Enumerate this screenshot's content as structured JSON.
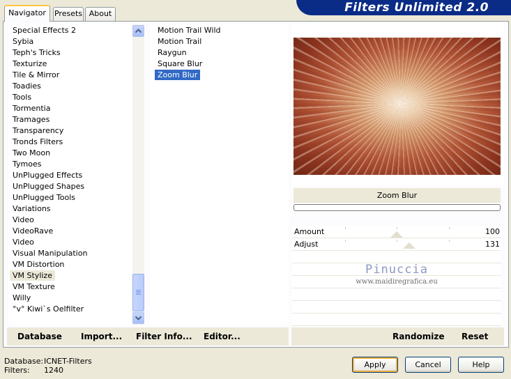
{
  "tabs": [
    {
      "label": "Navigator",
      "active": true
    },
    {
      "label": "Presets",
      "active": false
    },
    {
      "label": "About",
      "active": false
    }
  ],
  "banner_title": "Filters Unlimited 2.0",
  "categories": [
    "Special Effects 2",
    "Sybia",
    "Teph's Tricks",
    "Texturize",
    "Tile & Mirror",
    "Toadies",
    "Tools",
    "Tormentia",
    "Tramages",
    "Transparency",
    "Tronds Filters",
    "Two Moon",
    "Tymoes",
    "UnPlugged Effects",
    "UnPlugged Shapes",
    "UnPlugged Tools",
    "Variations",
    "Video",
    "VideoRave",
    "Video",
    "Visual Manipulation",
    "VM Distortion",
    "VM Stylize",
    "VM Texture",
    "Willy",
    "°v° Kiwi`s Oelfilter"
  ],
  "selected_category": "VM Stylize",
  "filters": [
    "Motion Trail Wild",
    "Motion Trail",
    "Raygun",
    "Square Blur",
    "Zoom Blur"
  ],
  "selected_filter": "Zoom Blur",
  "preview_filter_name": "Zoom Blur",
  "sliders": [
    {
      "label": "Amount",
      "value": "100",
      "level": 0.5
    },
    {
      "label": "Adjust",
      "value": "131",
      "level": 0.56
    }
  ],
  "watermark": {
    "name": "Pinuccia",
    "url": "www.maidiregrafica.eu"
  },
  "toolbar": {
    "database": "Database",
    "import": "Import...",
    "filter_info": "Filter Info...",
    "editor": "Editor...",
    "randomize": "Randomize",
    "reset": "Reset"
  },
  "status": {
    "database_label": "Database:",
    "database_value": "ICNET-Filters",
    "filters_label": "Filters:",
    "filters_value": "1240"
  },
  "buttons": {
    "apply": "Apply",
    "cancel": "Cancel",
    "help": "Help"
  },
  "colors": {
    "banner": "#0a2b86",
    "selection": "#316ac5",
    "window": "#ece9d8"
  }
}
